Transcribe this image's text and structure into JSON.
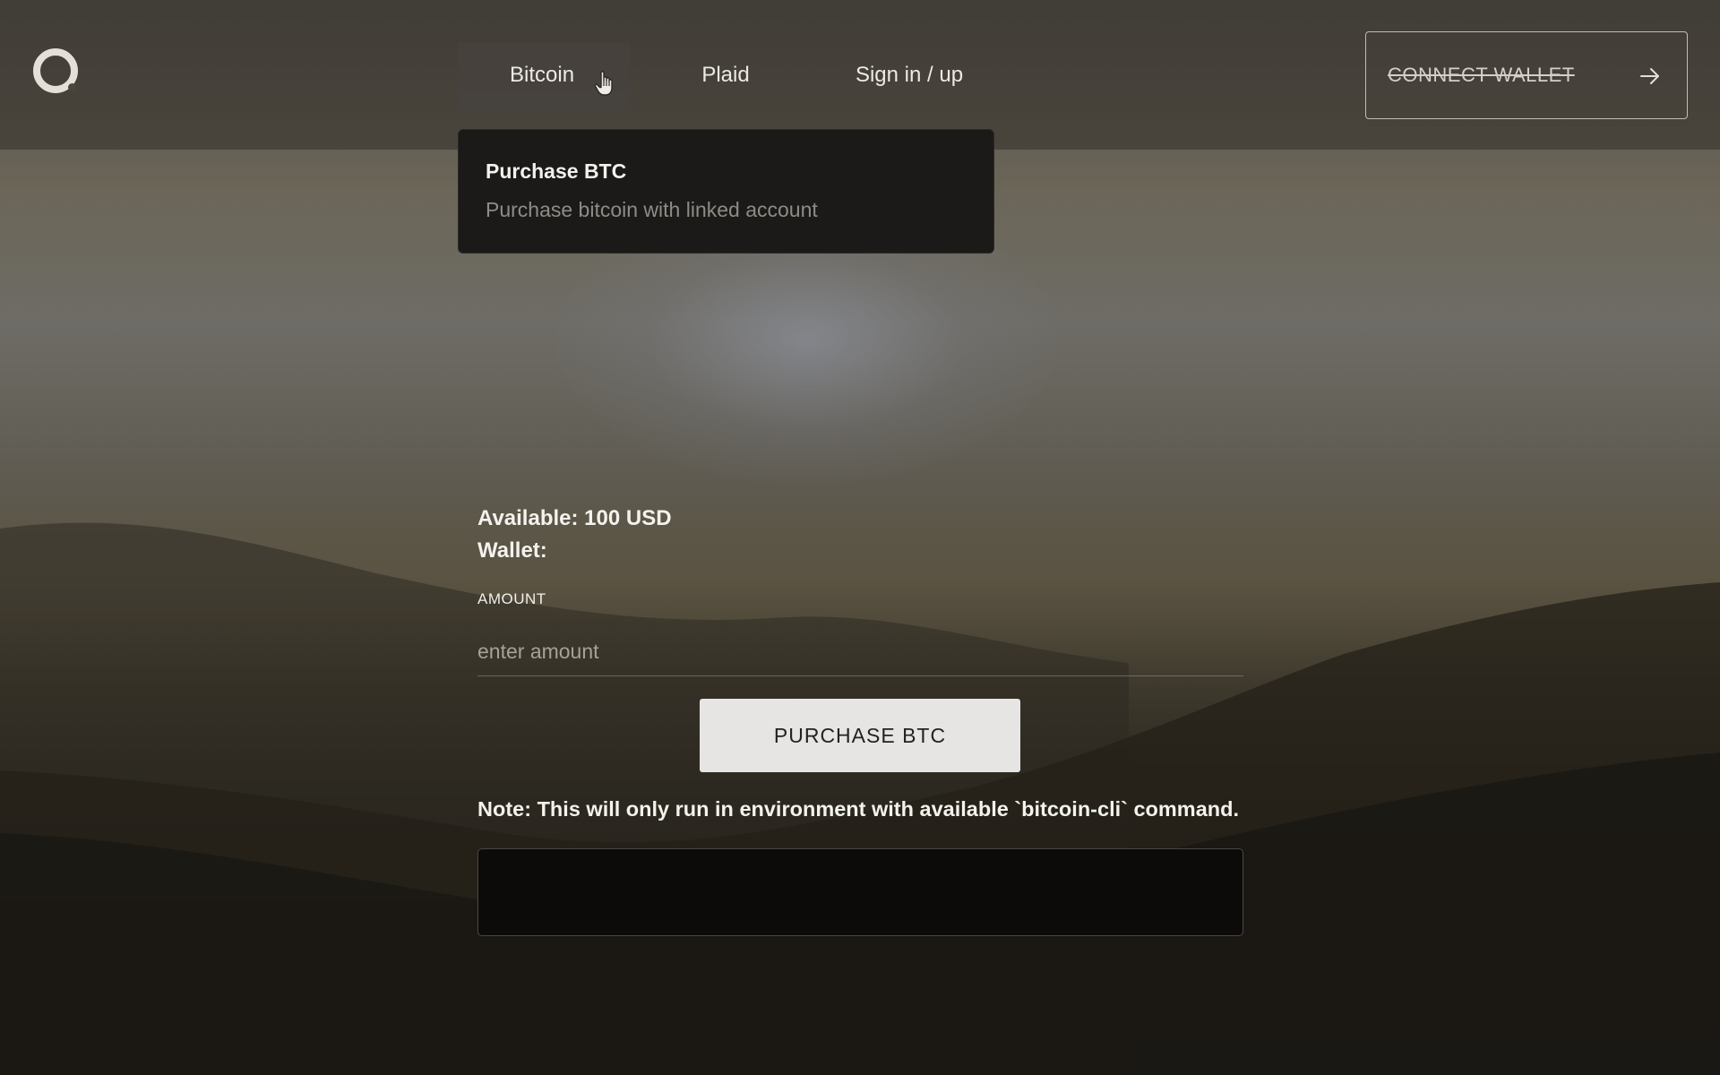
{
  "nav": {
    "items": [
      {
        "label": "Bitcoin"
      },
      {
        "label": "Plaid"
      },
      {
        "label": "Sign in / up"
      }
    ],
    "connect_wallet_label": "CONNECT WALLET"
  },
  "dropdown": {
    "items": [
      {
        "title": "Purchase BTC",
        "description": "Purchase bitcoin with linked account"
      }
    ]
  },
  "main": {
    "available": "Available: 100 USD",
    "wallet": "Wallet:",
    "amount_label": "AMOUNT",
    "amount_placeholder": "enter amount",
    "amount_value": "",
    "purchase_button_label": "PURCHASE BTC",
    "note": "Note: This will only run in environment with available `bitcoin-cli` command.",
    "output": ""
  },
  "icons": {
    "logo": "ring-logo-icon",
    "cursor": "hand-pointer-icon",
    "connect_arrow": "arrow-right-icon"
  },
  "colors": {
    "dropdown_bg": "#1b1a19",
    "button_bg": "#e6e5e3",
    "output_bg": "#0c0b0a"
  }
}
